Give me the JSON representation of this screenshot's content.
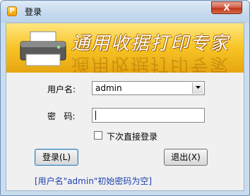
{
  "window": {
    "title": "登录",
    "icon_letter": "P",
    "close_label": "X"
  },
  "banner": {
    "title": "通用收据打印专家"
  },
  "form": {
    "username_label": "用户名:",
    "username_value": "admin",
    "password_label": "密   码:",
    "password_value": "",
    "auto_login_label": "下次直接登录",
    "auto_login_checked": false
  },
  "buttons": {
    "login": "登录(L)",
    "exit": "退出(X)"
  },
  "hint": "[用户名\"admin\"初始密码为空]",
  "colors": {
    "banner": "#f7c425",
    "hint": "#1c3fb0",
    "close": "#c0361c"
  }
}
